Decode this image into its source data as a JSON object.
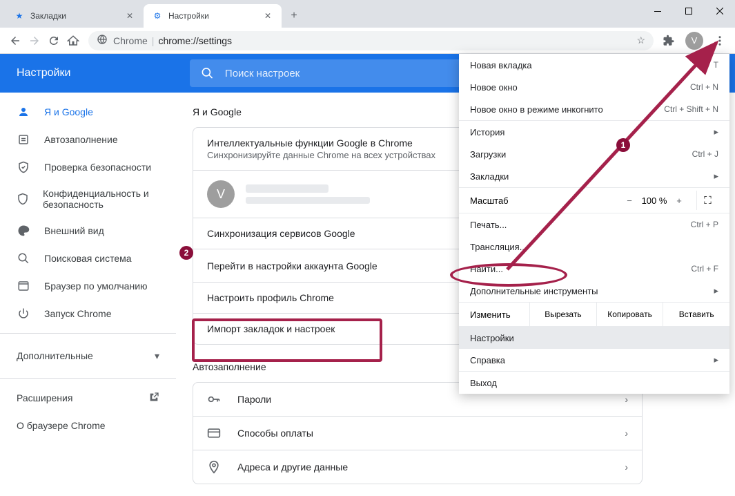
{
  "window": {
    "minimize": "—",
    "maximize": "☐",
    "close": "✕"
  },
  "tabs": [
    {
      "title": "Закладки",
      "favicon": "★"
    },
    {
      "title": "Настройки",
      "favicon": "⚙"
    }
  ],
  "newTab": "+",
  "addressBar": {
    "protocol_label": "Chrome",
    "url": "chrome://settings"
  },
  "profileInitial": "V",
  "settings": {
    "header": "Настройки",
    "searchPlaceholder": "Поиск настроек",
    "sidebar": [
      {
        "icon": "person",
        "label": "Я и Google"
      },
      {
        "icon": "autofill",
        "label": "Автозаполнение"
      },
      {
        "icon": "shield",
        "label": "Проверка безопасности"
      },
      {
        "icon": "shield2",
        "label": "Конфиденциальность и безопасность"
      },
      {
        "icon": "palette",
        "label": "Внешний вид"
      },
      {
        "icon": "search",
        "label": "Поисковая система"
      },
      {
        "icon": "browser",
        "label": "Браузер по умолчанию"
      },
      {
        "icon": "power",
        "label": "Запуск Chrome"
      }
    ],
    "advanced": "Дополнительные",
    "extensions": "Расширения",
    "about": "О браузере Chrome",
    "sections": {
      "youAndGoogle": {
        "title": "Я и Google",
        "smartTitle": "Интеллектуальные функции Google в Chrome",
        "smartSub": "Синхронизируйте данные Chrome на всех устройствах",
        "syncServices": "Синхронизация сервисов Google",
        "accountSettings": "Перейти в настройки аккаунта Google",
        "profile": "Настроить профиль Chrome",
        "importBookmarks": "Импорт закладок и настроек"
      },
      "autofill": {
        "title": "Автозаполнение",
        "passwords": "Пароли",
        "payment": "Способы оплаты",
        "addresses": "Адреса и другие данные"
      }
    }
  },
  "menu": {
    "newTab": "Новая вкладка",
    "newTabKey": "T",
    "newWindow": "Новое окно",
    "newWindowKey": "Ctrl + N",
    "incognito": "Новое окно в режиме инкогнито",
    "incognitoKey": "Ctrl + Shift + N",
    "history": "История",
    "downloads": "Загрузки",
    "downloadsKey": "Ctrl + J",
    "bookmarks": "Закладки",
    "zoomLabel": "Масштаб",
    "zoomValue": "100 %",
    "zoomMinus": "−",
    "zoomPlus": "+",
    "print": "Печать...",
    "printKey": "Ctrl + P",
    "cast": "Трансляция...",
    "find": "Найти...",
    "findKey": "Ctrl + F",
    "moreTools": "Дополнительные инструменты",
    "editLabel": "Изменить",
    "cut": "Вырезать",
    "copy": "Копировать",
    "paste": "Вставить",
    "settings": "Настройки",
    "help": "Справка",
    "exit": "Выход"
  },
  "annotations": {
    "badge1": "1",
    "badge2": "2"
  }
}
